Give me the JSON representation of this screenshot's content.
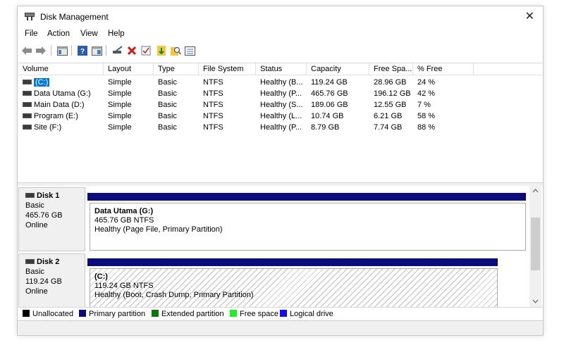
{
  "window": {
    "title": "Disk Management"
  },
  "menu": [
    "File",
    "Action",
    "View",
    "Help"
  ],
  "toolbar_icons": [
    "back-icon",
    "forward-icon",
    "console-tree-icon",
    "help-icon",
    "properties-icon",
    "connect-disk-icon",
    "delete-icon",
    "checkmark-icon",
    "import-icon",
    "search-icon",
    "list-view-icon"
  ],
  "volume_table": {
    "headers": [
      "Volume",
      "Layout",
      "Type",
      "File System",
      "Status",
      "Capacity",
      "Free Spa...",
      "% Free"
    ],
    "rows": [
      {
        "volume": "(C:)",
        "layout": "Simple",
        "type": "Basic",
        "fs": "NTFS",
        "status": "Healthy (B...",
        "capacity": "119.24 GB",
        "free": "28.96 GB",
        "pct": "24 %"
      },
      {
        "volume": "Data Utama (G:)",
        "layout": "Simple",
        "type": "Basic",
        "fs": "NTFS",
        "status": "Healthy (P...",
        "capacity": "465.76 GB",
        "free": "196.12 GB",
        "pct": "42 %"
      },
      {
        "volume": "Main Data (D:)",
        "layout": "Simple",
        "type": "Basic",
        "fs": "NTFS",
        "status": "Healthy (S...",
        "capacity": "189.06 GB",
        "free": "12.55 GB",
        "pct": "7 %"
      },
      {
        "volume": "Program (E:)",
        "layout": "Simple",
        "type": "Basic",
        "fs": "NTFS",
        "status": "Healthy (L...",
        "capacity": "10.74 GB",
        "free": "6.21 GB",
        "pct": "58 %"
      },
      {
        "volume": "Site (F:)",
        "layout": "Simple",
        "type": "Basic",
        "fs": "NTFS",
        "status": "Healthy (P...",
        "capacity": "8.79 GB",
        "free": "7.74 GB",
        "pct": "88 %"
      }
    ]
  },
  "disks": [
    {
      "name": "Disk 1",
      "type": "Basic",
      "size": "465.76 GB",
      "state": "Online",
      "partition": {
        "name": "Data Utama  (G:)",
        "size_fs": "465.76 GB NTFS",
        "status": "Healthy (Page File, Primary Partition)"
      }
    },
    {
      "name": "Disk 2",
      "type": "Basic",
      "size": "119.24 GB",
      "state": "Online",
      "partition": {
        "name": "(C:)",
        "size_fs": "119.24 GB NTFS",
        "status": "Healthy (Boot, Crash Dump, Primary Partition)"
      }
    }
  ],
  "legend": [
    {
      "label": "Unallocated",
      "color": "#000000"
    },
    {
      "label": "Primary partition",
      "color": "#0b0b7b"
    },
    {
      "label": "Extended partition",
      "color": "#0a7a0a"
    },
    {
      "label": "Free space",
      "color": "#22ee22"
    },
    {
      "label": "Logical drive",
      "color": "#1010ee"
    }
  ],
  "colors": {
    "primary_bar": "#0b0b7b",
    "selection": "#0078d7"
  }
}
